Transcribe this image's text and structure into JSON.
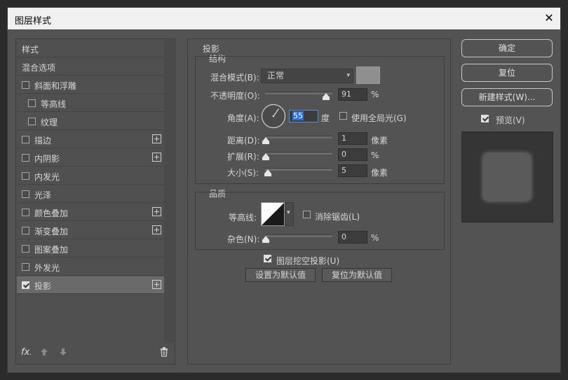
{
  "window": {
    "title": "图层样式",
    "close_glyph": "✕"
  },
  "left_panel": {
    "items": [
      {
        "label": "样式",
        "checkbox": false,
        "checked": false,
        "plus": false,
        "indent": false,
        "selected": false
      },
      {
        "label": "混合选项",
        "checkbox": false,
        "checked": false,
        "plus": false,
        "indent": false,
        "selected": false
      },
      {
        "label": "斜面和浮雕",
        "checkbox": true,
        "checked": false,
        "plus": false,
        "indent": false,
        "selected": false
      },
      {
        "label": "等高线",
        "checkbox": true,
        "checked": false,
        "plus": false,
        "indent": true,
        "selected": false
      },
      {
        "label": "纹理",
        "checkbox": true,
        "checked": false,
        "plus": false,
        "indent": true,
        "selected": false
      },
      {
        "label": "描边",
        "checkbox": true,
        "checked": false,
        "plus": true,
        "indent": false,
        "selected": false
      },
      {
        "label": "内阴影",
        "checkbox": true,
        "checked": false,
        "plus": true,
        "indent": false,
        "selected": false
      },
      {
        "label": "内发光",
        "checkbox": true,
        "checked": false,
        "plus": false,
        "indent": false,
        "selected": false
      },
      {
        "label": "光泽",
        "checkbox": true,
        "checked": false,
        "plus": false,
        "indent": false,
        "selected": false
      },
      {
        "label": "颜色叠加",
        "checkbox": true,
        "checked": false,
        "plus": true,
        "indent": false,
        "selected": false
      },
      {
        "label": "渐变叠加",
        "checkbox": true,
        "checked": false,
        "plus": true,
        "indent": false,
        "selected": false
      },
      {
        "label": "图案叠加",
        "checkbox": true,
        "checked": false,
        "plus": false,
        "indent": false,
        "selected": false
      },
      {
        "label": "外发光",
        "checkbox": true,
        "checked": false,
        "plus": false,
        "indent": false,
        "selected": false
      },
      {
        "label": "投影",
        "checkbox": true,
        "checked": true,
        "plus": true,
        "indent": false,
        "selected": true
      }
    ],
    "footer": {
      "fx_label": "fx",
      "fx_suffix": "."
    }
  },
  "drop_shadow": {
    "section_title": "投影",
    "structure": {
      "title": "结构",
      "blend_mode_label": "混合模式(B):",
      "blend_mode_value": "正常",
      "shadow_color": "#8f8f8f",
      "opacity_label": "不透明度(O):",
      "opacity_value": "91",
      "opacity_unit": "%",
      "opacity_fraction": 0.91,
      "angle_label": "角度(A):",
      "angle_value": "55",
      "angle_unit": "度",
      "global_light_label": "使用全局光(G)",
      "global_light_checked": false,
      "distance_label": "距离(D):",
      "distance_value": "1",
      "distance_unit": "像素",
      "spread_label": "扩展(R):",
      "spread_value": "0",
      "spread_unit": "%",
      "size_label": "大小(S):",
      "size_value": "5",
      "size_unit": "像素"
    },
    "quality": {
      "title": "品质",
      "contour_label": "等高线:",
      "antialias_label": "消除锯齿(L)",
      "antialias_checked": false,
      "noise_label": "杂色(N):",
      "noise_value": "0",
      "noise_unit": "%"
    },
    "knockout_label": "图层挖空投影(U)",
    "knockout_checked": true,
    "set_default_label": "设置为默认值",
    "reset_default_label": "复位为默认值"
  },
  "right_panel": {
    "ok_label": "确定",
    "reset_label": "复位",
    "new_style_label": "新建样式(W)...",
    "preview_label": "预览(V)",
    "preview_checked": true
  }
}
